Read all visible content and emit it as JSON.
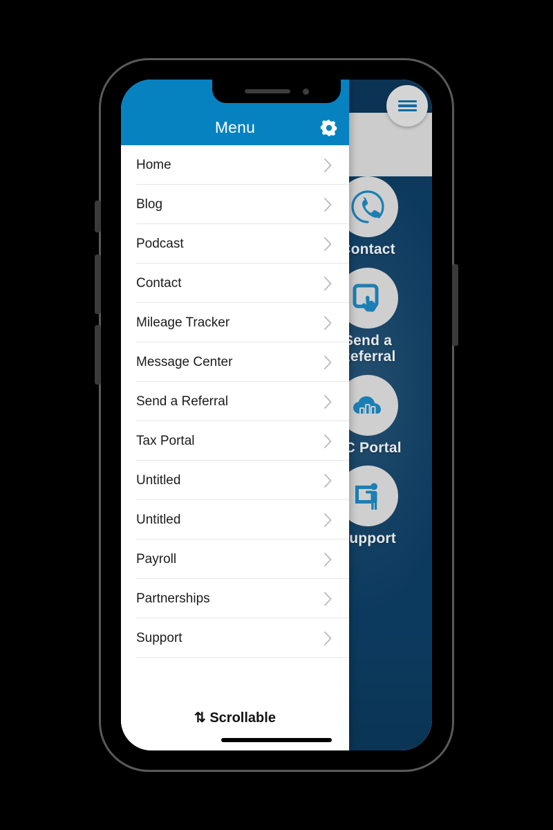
{
  "device": {
    "type": "smartphone-mockup",
    "notch": {
      "speaker": "speaker-grille",
      "camera": "front-camera"
    },
    "buttons": [
      "mute-switch",
      "volume-up",
      "volume-down",
      "power"
    ]
  },
  "floating_button": {
    "name": "hamburger-menu-button",
    "icon": "hamburger-icon",
    "bar_color": "#14699e",
    "background": "#d4d4d4"
  },
  "menu_panel": {
    "header": {
      "title": "Menu",
      "background": "#0682c0",
      "title_color": "#ffffff",
      "settings_icon": "gear-icon"
    },
    "items": [
      {
        "label": "Home",
        "chevron": "chevron-right-icon"
      },
      {
        "label": "Blog",
        "chevron": "chevron-right-icon"
      },
      {
        "label": "Podcast",
        "chevron": "chevron-right-icon"
      },
      {
        "label": "Contact",
        "chevron": "chevron-right-icon"
      },
      {
        "label": "Mileage Tracker",
        "chevron": "chevron-right-icon"
      },
      {
        "label": "Message Center",
        "chevron": "chevron-right-icon"
      },
      {
        "label": "Send a Referral",
        "chevron": "chevron-right-icon"
      },
      {
        "label": "Tax Portal",
        "chevron": "chevron-right-icon"
      },
      {
        "label": "Untitled",
        "chevron": "chevron-right-icon"
      },
      {
        "label": "Untitled",
        "chevron": "chevron-right-icon"
      },
      {
        "label": "Payroll",
        "chevron": "chevron-right-icon"
      },
      {
        "label": "Partnerships",
        "chevron": "chevron-right-icon"
      },
      {
        "label": "Support",
        "chevron": "chevron-right-icon"
      }
    ],
    "scroll_hint": "⇅ Scrollable"
  },
  "app_background": {
    "panel_color": "#0c3a5e",
    "header_band_color": "#cccccc",
    "accent_color": "#1b7fb3",
    "tiles": [
      {
        "label": "Contact",
        "icon": "phone-circle-icon"
      },
      {
        "label": "Send a\nReferral",
        "label_line1": "Send a",
        "label_line2": "Referral",
        "icon": "tablet-tap-icon"
      },
      {
        "label": "CC Portal",
        "icon": "cloud-chart-icon"
      },
      {
        "label": "Support",
        "icon": "presenter-person-icon"
      }
    ]
  }
}
